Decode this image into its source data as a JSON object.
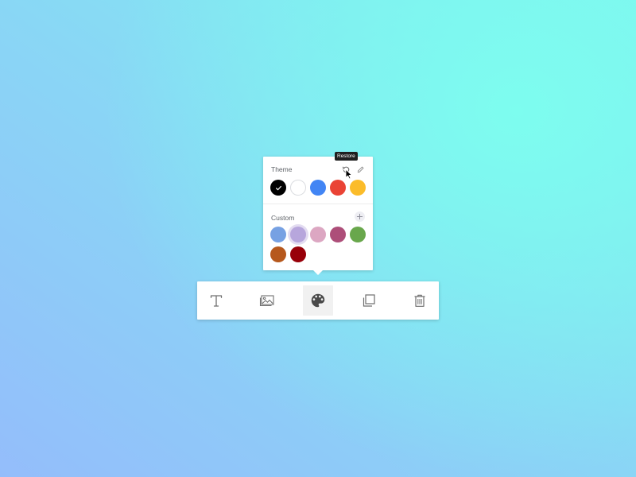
{
  "palette_panel": {
    "theme_label": "Theme",
    "custom_label": "Custom",
    "restore_tooltip": "Restore",
    "selected_theme_color": "#000000",
    "hovered_custom_color": "#b7a6dc",
    "header_icons": [
      "restore-icon",
      "edit-icon"
    ],
    "custom_header_icon": "add-icon",
    "theme_colors": [
      "#000000",
      "#ffffff",
      "#4285f4",
      "#ea4335",
      "#fbbc2a"
    ],
    "custom_colors": [
      "#77a1e3",
      "#b7a6dc",
      "#dca7c2",
      "#ad4e79",
      "#69a74c",
      "#b6581d",
      "#980009"
    ]
  },
  "toolbar": {
    "tools": [
      {
        "name": "text-tool-button",
        "icon": "text-icon"
      },
      {
        "name": "image-tool-button",
        "icon": "image-icon"
      },
      {
        "name": "palette-tool-button",
        "icon": "palette-icon",
        "active": true
      },
      {
        "name": "duplicate-tool-button",
        "icon": "copy-icon"
      },
      {
        "name": "delete-tool-button",
        "icon": "trash-icon"
      }
    ]
  }
}
